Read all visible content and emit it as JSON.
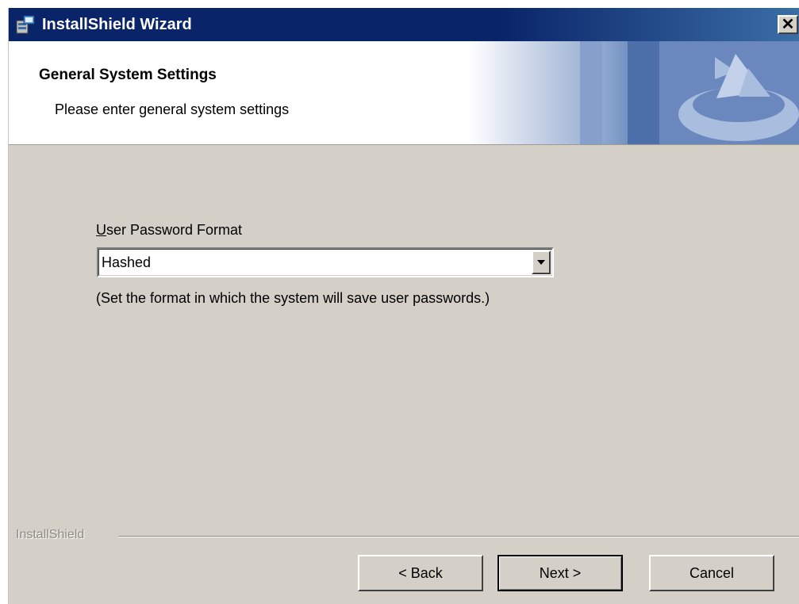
{
  "window": {
    "title": "InstallShield Wizard",
    "close_symbol": "✕"
  },
  "header": {
    "title": "General System Settings",
    "subtitle": "Please enter general system settings"
  },
  "form": {
    "password_format": {
      "label_accel": "U",
      "label_rest": "ser Password Format",
      "selected_value": "Hashed",
      "hint": "(Set the format in which the system will save user passwords.)"
    }
  },
  "footer": {
    "brand": "InstallShield",
    "back_label": "< Back",
    "next_label": "Next >",
    "cancel_label": "Cancel"
  },
  "icons": {
    "app": "installer-app-icon",
    "close": "close-icon",
    "dropdown": "chevron-down-icon",
    "logo": "installshield-logo-icon"
  },
  "colors": {
    "titlebar": "#0a246a",
    "dialog_bg": "#d4d0c8",
    "header_bg": "#ffffff",
    "logo_blue": "#6a88bd"
  }
}
